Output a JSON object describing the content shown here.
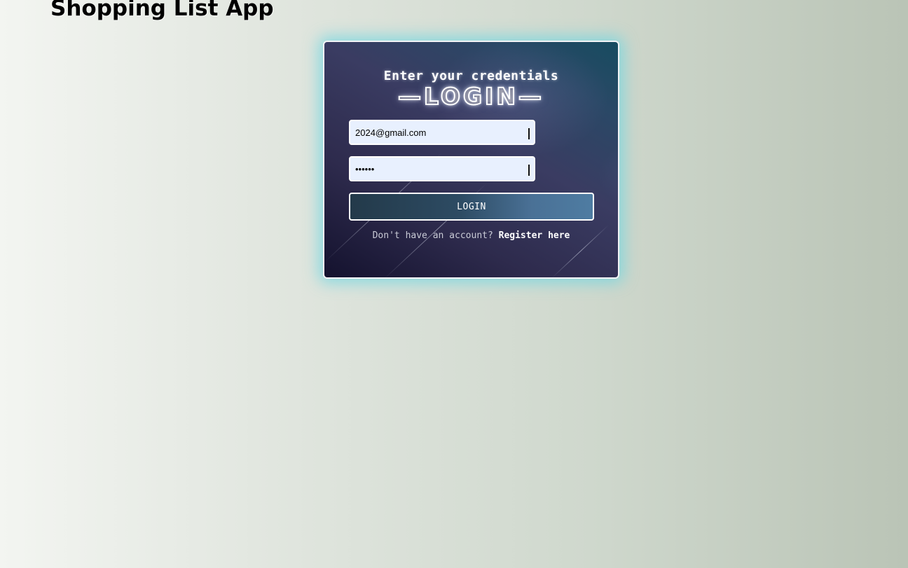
{
  "app": {
    "title": "Shopping List App"
  },
  "login_card": {
    "subtitle": "Enter your credentials",
    "heading": "—LOGIN—",
    "email": {
      "value": "2024@gmail.com",
      "type": "email"
    },
    "password": {
      "value": "••••••",
      "type": "password"
    },
    "submit_label": "LOGIN",
    "register_prompt": "Don't have an account?",
    "register_link": "Register here"
  },
  "colors": {
    "card_glow": "#6ed6e0",
    "input_background": "#e8f0fe",
    "button_gradient_start": "#233a4a",
    "button_gradient_end": "#4e7ca2"
  }
}
